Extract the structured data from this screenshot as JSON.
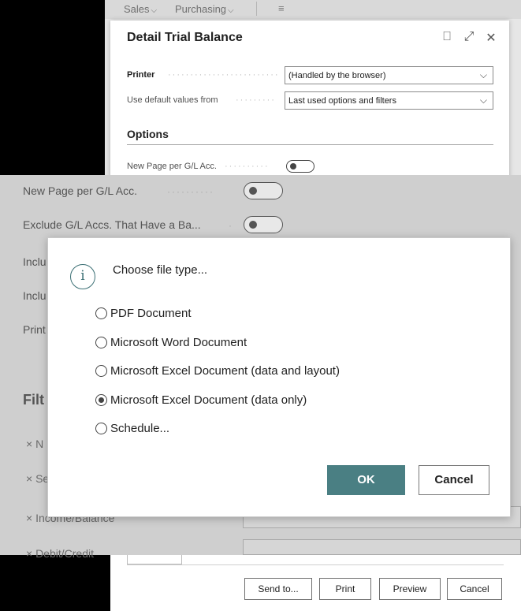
{
  "top_nav": {
    "items": [
      "Sales",
      "Purchasing"
    ],
    "chevron": "⌵",
    "menu_icon": "≡"
  },
  "main_dialog": {
    "title": "Detail Trial Balance",
    "icons": {
      "bookmark": "⎕",
      "expand": "⤢",
      "close": "✕"
    },
    "printer": {
      "label": "Printer",
      "value": "(Handled by the browser)"
    },
    "defaults": {
      "label": "Use default values from",
      "value": "Last used options and filters"
    },
    "options_title": "Options",
    "new_page_label": "New Page per G/L Acc."
  },
  "grey_page": {
    "new_page_label": "New Page per G/L Acc.",
    "exclude_label": "Exclude G/L Accs. That Have a Ba...",
    "incl_1": "Inclu",
    "incl_2": "Inclu",
    "print_label": "Print",
    "filters_label": "Filt",
    "filter_1": "× N",
    "filter_2": "× Se",
    "filter_3": "× Income/Balance",
    "filter_4": "× Debit/Credit"
  },
  "modal": {
    "prompt": "Choose file type...",
    "options": [
      {
        "label": "PDF Document",
        "checked": false
      },
      {
        "label": "Microsoft Word Document",
        "checked": false
      },
      {
        "label": "Microsoft Excel Document (data and layout)",
        "checked": false
      },
      {
        "label": "Microsoft Excel Document (data only)",
        "checked": true
      },
      {
        "label": "Schedule...",
        "checked": false
      }
    ],
    "ok_label": "OK",
    "cancel_label": "Cancel"
  },
  "bottom_actions": {
    "send_to": "Send to...",
    "print": "Print",
    "preview": "Preview",
    "cancel": "Cancel"
  },
  "colors": {
    "accent": "#4a7f83",
    "overlay": "#cfcfcf"
  }
}
